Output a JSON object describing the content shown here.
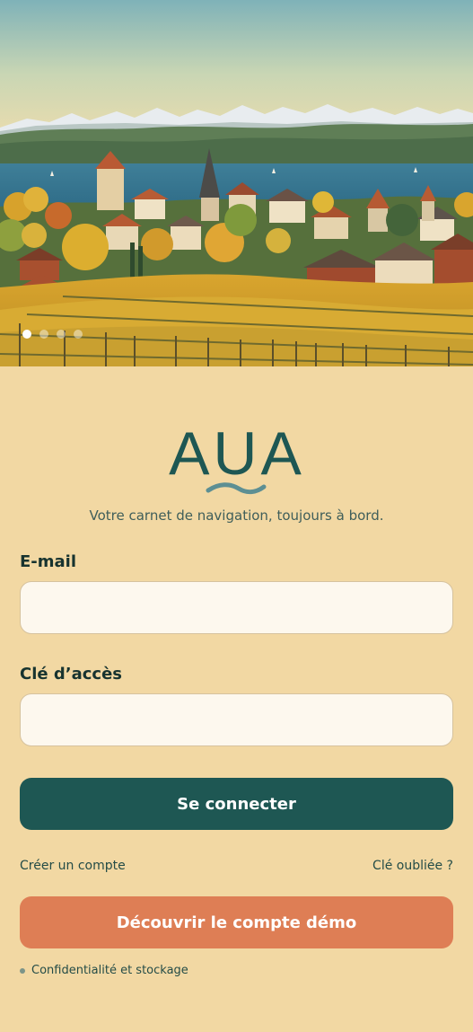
{
  "hero": {
    "slide_count": 4,
    "active_slide": 0
  },
  "brand": {
    "logo_text": "AUA",
    "tagline": "Votre carnet de navigation, toujours à bord."
  },
  "form": {
    "email_label": "E-mail",
    "email_value": "",
    "key_label": "Clé d’accès",
    "key_value": "",
    "submit_label": "Se connecter"
  },
  "links": {
    "create_account": "Créer un compte",
    "forgot_key": "Clé oubliée ?"
  },
  "demo_button": "Découvrir le compte démo",
  "footer": {
    "privacy": "Confidentialité et stockage"
  },
  "colors": {
    "background": "#f2d8a3",
    "primary": "#1e5753",
    "accent": "#de7e55"
  }
}
